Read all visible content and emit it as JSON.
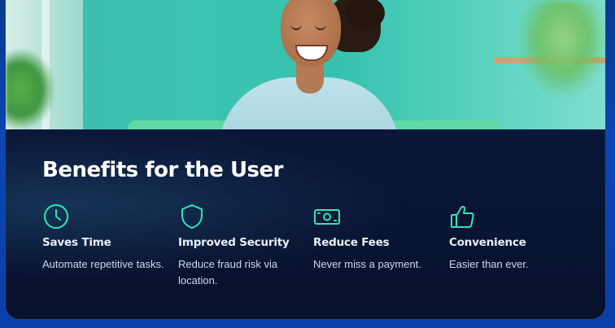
{
  "section": {
    "title": "Benefits for the User"
  },
  "benefits": [
    {
      "icon": "clock-icon",
      "title": "Saves Time",
      "description": "Automate repetitive tasks."
    },
    {
      "icon": "shield-icon",
      "title": "Improved Security",
      "description": "Reduce fraud risk via location."
    },
    {
      "icon": "banknote-icon",
      "title": "Reduce Fees",
      "description": "Never miss a payment."
    },
    {
      "icon": "thumbs-up-icon",
      "title": "Convenience",
      "description": "Easier than ever."
    }
  ],
  "colors": {
    "accent": "#2ee6b8",
    "panel_bg": "#07112d",
    "page_bg": "#0b46b4",
    "title_text": "#ffffff",
    "body_text": "#cfd7ea"
  }
}
